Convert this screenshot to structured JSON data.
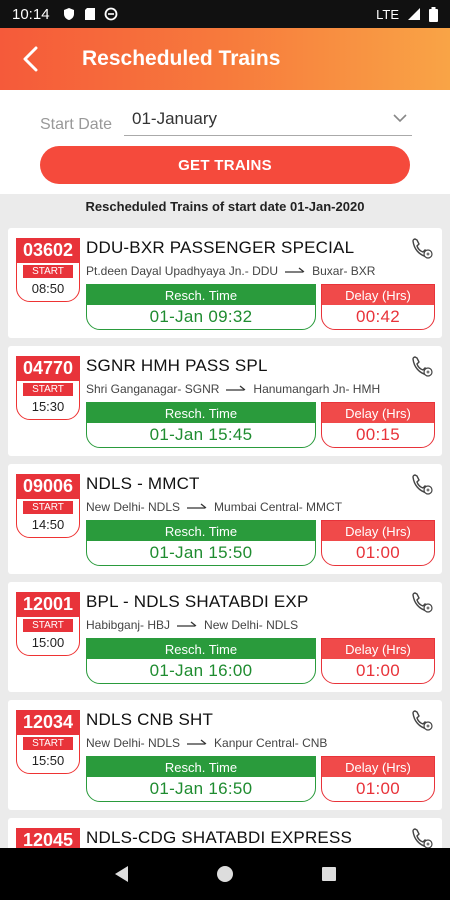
{
  "status": {
    "time": "10:14",
    "network": "LTE"
  },
  "appbar": {
    "title": "Rescheduled Trains"
  },
  "filter": {
    "start_date_label": "Start Date",
    "start_date_value": "01-January",
    "button_label": "GET TRAINS"
  },
  "list_title": "Rescheduled Trains of start date 01-Jan-2020",
  "columns": {
    "start": "START",
    "resch": "Resch. Time",
    "delay": "Delay (Hrs)"
  },
  "trains": [
    {
      "number": "03602",
      "name": "DDU-BXR PASSENGER SPECIAL",
      "start_time": "08:50",
      "from": "Pt.deen Dayal Upadhyaya Jn.- DDU",
      "to": "Buxar- BXR",
      "resch_time": "01-Jan 09:32",
      "delay": "00:42"
    },
    {
      "number": "04770",
      "name": "SGNR HMH PASS SPL",
      "start_time": "15:30",
      "from": "Shri Ganganagar- SGNR",
      "to": "Hanumangarh Jn- HMH",
      "resch_time": "01-Jan 15:45",
      "delay": "00:15"
    },
    {
      "number": "09006",
      "name": "NDLS - MMCT",
      "start_time": "14:50",
      "from": "New Delhi- NDLS",
      "to": "Mumbai Central- MMCT",
      "resch_time": "01-Jan 15:50",
      "delay": "01:00"
    },
    {
      "number": "12001",
      "name": "BPL - NDLS SHATABDI EXP",
      "start_time": "15:00",
      "from": "Habibganj- HBJ",
      "to": "New Delhi- NDLS",
      "resch_time": "01-Jan 16:00",
      "delay": "01:00"
    },
    {
      "number": "12034",
      "name": "NDLS CNB SHT",
      "start_time": "15:50",
      "from": "New Delhi- NDLS",
      "to": "Kanpur Central- CNB",
      "resch_time": "01-Jan 16:50",
      "delay": "01:00"
    },
    {
      "number": "12045",
      "name": "NDLS-CDG SHATABDI EXPRESS",
      "start_time": "",
      "from": "",
      "to": "",
      "resch_time": "",
      "delay": ""
    }
  ],
  "colors": {
    "accent": "#f54a3c",
    "green": "#2a9b3c",
    "red": "#e8333a"
  }
}
